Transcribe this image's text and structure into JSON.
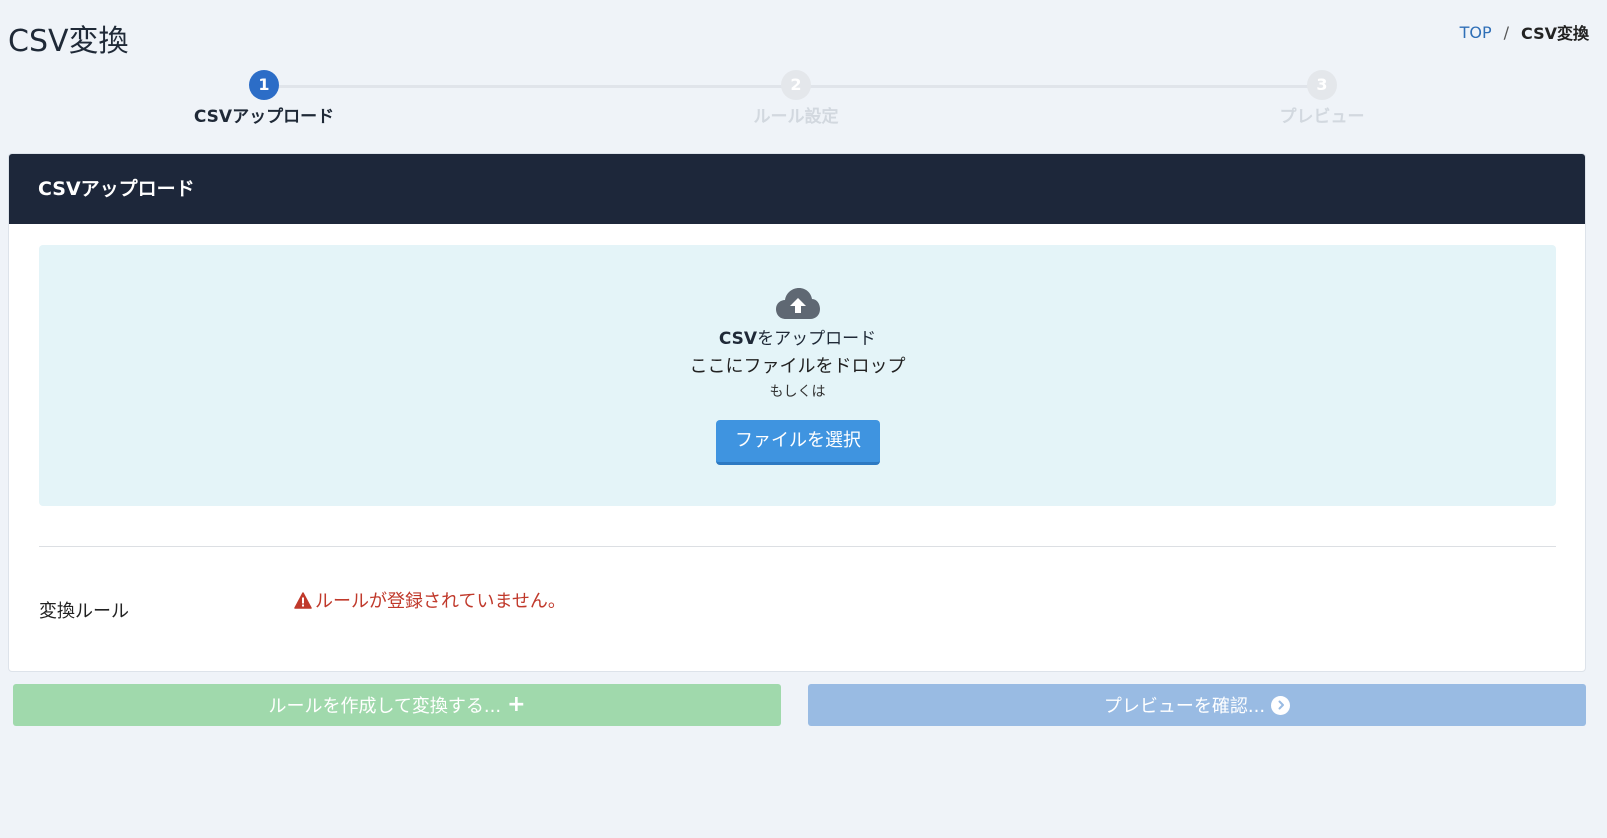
{
  "header": {
    "title": "CSV変換",
    "breadcrumb": {
      "home": "TOP",
      "separator": "/",
      "current": "CSV変換"
    }
  },
  "stepper": {
    "steps": [
      {
        "number": "1",
        "label": "CSVアップロード",
        "state": "active"
      },
      {
        "number": "2",
        "label": "ルール設定",
        "state": "inactive"
      },
      {
        "number": "3",
        "label": "プレビュー",
        "state": "inactive"
      }
    ]
  },
  "card": {
    "header": "CSVアップロード",
    "dropzone": {
      "icon": "cloud-upload-icon",
      "title_strong": "CSV",
      "title_rest": "をアップロード",
      "drop_text": "ここにファイルをドロップ",
      "or_text": "もしくは",
      "button_label": "ファイルを選択"
    },
    "rule": {
      "label": "変換ルール",
      "error_icon": "warning-icon",
      "error_text": "ルールが登録されていません。"
    }
  },
  "actions": {
    "create_label": "ルールを作成して変換する...",
    "create_icon": "plus-icon",
    "preview_label": "プレビューを確認...",
    "preview_icon": "circle-chevron-right-icon"
  },
  "colors": {
    "accent": "#2c6dc7",
    "card_header_bg": "#1d273a",
    "dropzone_bg": "#e4f4f8",
    "error": "#c0392b",
    "create_button": "#a0d9ac",
    "preview_button": "#99bbe3"
  }
}
